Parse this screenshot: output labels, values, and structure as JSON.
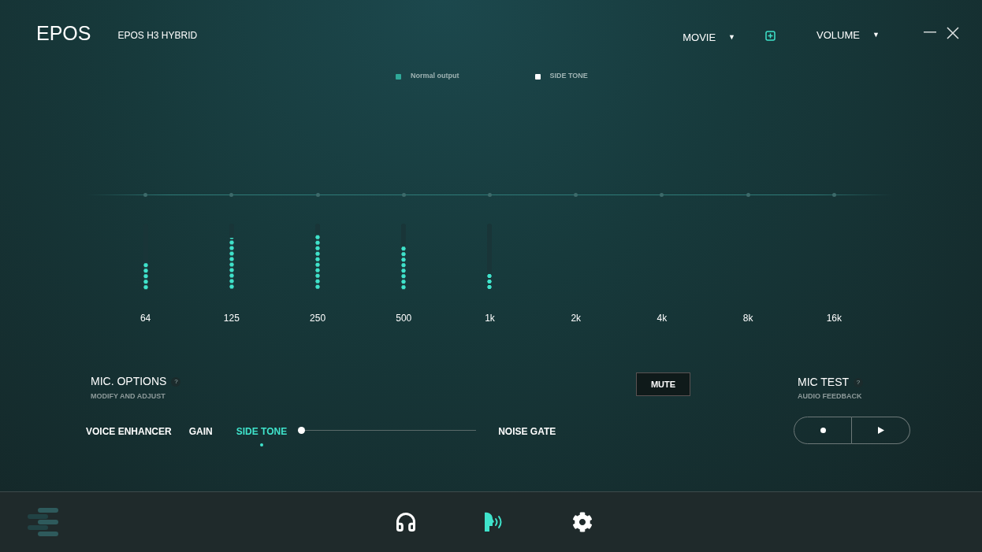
{
  "header": {
    "logo": "EPOS",
    "device": "EPOS H3 HYBRID",
    "preset": {
      "label": "MOVIE",
      "caret": "▼"
    },
    "mode": {
      "label": "VOLUME",
      "caret": "▼"
    }
  },
  "legend": [
    {
      "label": "Normal output",
      "color": "#2fa898"
    },
    {
      "label": "SIDE TONE",
      "color": "#ffffff"
    }
  ],
  "bands": [
    {
      "label": "64",
      "level": 0.42
    },
    {
      "label": "125",
      "level": 0.78
    },
    {
      "label": "250",
      "level": 0.83
    },
    {
      "label": "500",
      "level": 0.67
    },
    {
      "label": "1k",
      "level": 0.25
    },
    {
      "label": "2k"
    },
    {
      "label": "4k"
    },
    {
      "label": "8k"
    },
    {
      "label": "16k"
    }
  ],
  "mic_options": {
    "title": "MIC. OPTIONS",
    "help": "?",
    "subtitle": "MODIFY AND ADJUST"
  },
  "mute_button": "MUTE",
  "mic_test": {
    "title": "MIC TEST",
    "help": "?",
    "subtitle": "AUDIO FEEDBACK"
  },
  "mic_tabs": [
    {
      "label": "VOICE ENHANCER",
      "selected": false
    },
    {
      "label": "GAIN",
      "selected": false
    },
    {
      "label": "SIDE TONE",
      "selected": true
    }
  ],
  "side_tone_slider": {
    "level": 0
  },
  "noise_gate": {
    "label": "NOISE GATE",
    "selected": false
  },
  "nav_items": [
    {
      "kind": "headphones",
      "selected": false
    },
    {
      "kind": "voice",
      "selected": true
    },
    {
      "kind": "settings",
      "selected": false
    }
  ]
}
